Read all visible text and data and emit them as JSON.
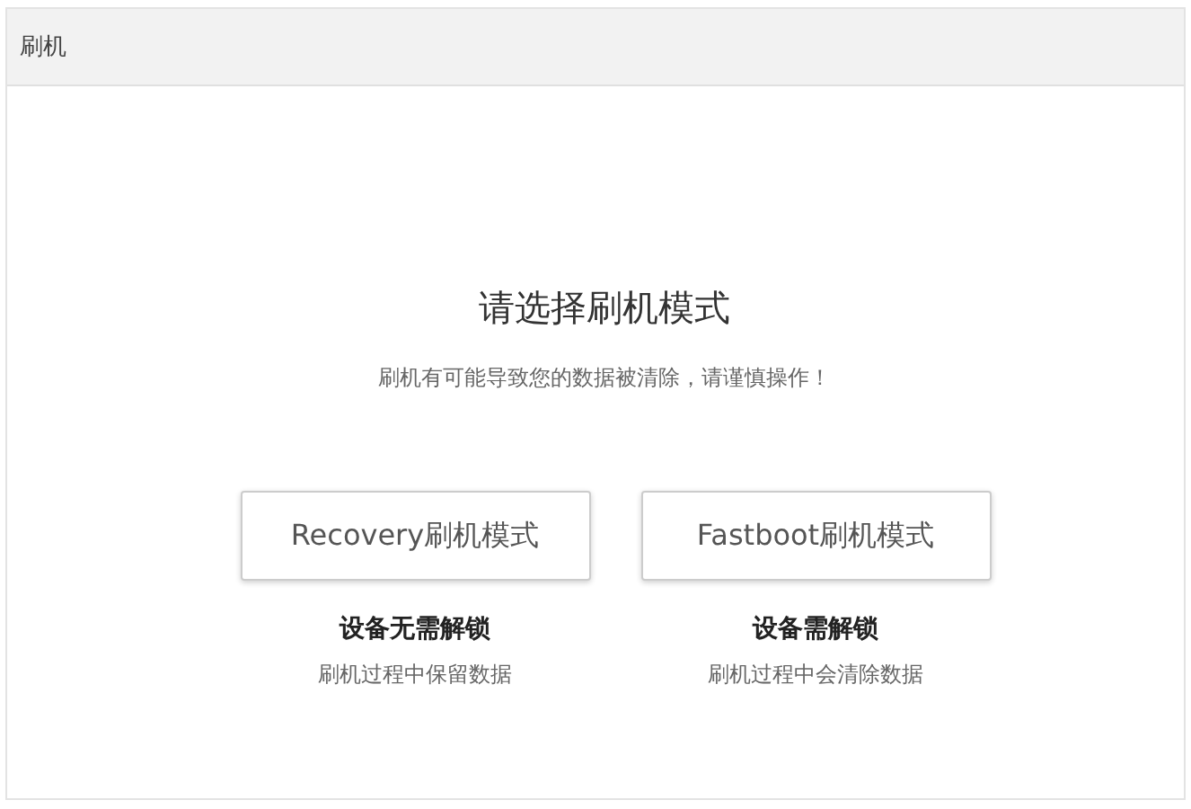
{
  "window": {
    "title": "刷机"
  },
  "heading": "请选择刷机模式",
  "warning": "刷机有可能导致您的数据被清除，请谨慎操作！",
  "modes": [
    {
      "button": "Recovery刷机模式",
      "requirement": "设备无需解锁",
      "note": "刷机过程中保留数据"
    },
    {
      "button": "Fastboot刷机模式",
      "requirement": "设备需解锁",
      "note": "刷机过程中会清除数据"
    }
  ]
}
